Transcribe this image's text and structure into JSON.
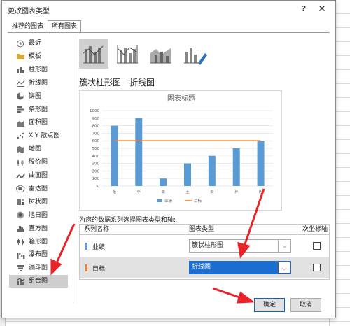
{
  "dialog": {
    "title": "更改图表类型",
    "help_label": "?",
    "close_label": "✕"
  },
  "tabs": [
    "推荐的图表",
    "所有图表"
  ],
  "sidebar": {
    "items": [
      {
        "label": "最近",
        "icon": "recent-icon"
      },
      {
        "label": "模板",
        "icon": "folder-icon"
      },
      {
        "label": "柱形图",
        "icon": "column-chart-icon"
      },
      {
        "label": "折线图",
        "icon": "line-chart-icon"
      },
      {
        "label": "饼图",
        "icon": "pie-chart-icon"
      },
      {
        "label": "条形图",
        "icon": "bar-chart-icon"
      },
      {
        "label": "面积图",
        "icon": "area-chart-icon"
      },
      {
        "label": "X Y 散点图",
        "icon": "scatter-chart-icon"
      },
      {
        "label": "地图",
        "icon": "map-chart-icon"
      },
      {
        "label": "股价图",
        "icon": "stock-chart-icon"
      },
      {
        "label": "曲面图",
        "icon": "surface-chart-icon"
      },
      {
        "label": "雷达图",
        "icon": "radar-chart-icon"
      },
      {
        "label": "树状图",
        "icon": "treemap-chart-icon"
      },
      {
        "label": "旭日图",
        "icon": "sunburst-chart-icon"
      },
      {
        "label": "直方图",
        "icon": "histogram-chart-icon"
      },
      {
        "label": "箱形图",
        "icon": "boxwhisker-chart-icon"
      },
      {
        "label": "瀑布图",
        "icon": "waterfall-chart-icon"
      },
      {
        "label": "漏斗图",
        "icon": "funnel-chart-icon"
      },
      {
        "label": "组合图",
        "icon": "combo-chart-icon",
        "selected": true
      }
    ]
  },
  "combo_type_title": "簇状柱形图 - 折线图",
  "chart_data": {
    "type": "bar",
    "title": "图表标题",
    "categories": [
      "张",
      "李",
      "周",
      "王",
      "吴",
      "孙",
      "巴"
    ],
    "series": [
      {
        "name": "业绩",
        "type": "bar",
        "values": [
          800,
          900,
          100,
          300,
          400,
          500,
          600
        ],
        "color": "#5b9bd5"
      },
      {
        "name": "目标",
        "type": "line",
        "values": [
          600,
          600,
          600,
          600,
          600,
          600,
          600
        ],
        "color": "#ed7d31"
      }
    ],
    "ylim": [
      0,
      1000
    ],
    "yticks": [
      0,
      100,
      200,
      300,
      400,
      500,
      600,
      700,
      800,
      900,
      1000
    ],
    "grid": true,
    "legend_position": "bottom"
  },
  "series_config": {
    "prompt": "为您的数据系列选择图表类型和轴:",
    "headers": {
      "name": "系列名称",
      "type": "图表类型",
      "axis": "次坐标轴"
    },
    "rows": [
      {
        "name": "业绩",
        "color": "#5b9bd5",
        "chart_type": "簇状柱形图",
        "secondary_axis": false
      },
      {
        "name": "目标",
        "color": "#ed7d31",
        "chart_type": "折线图",
        "secondary_axis": false,
        "selected": true
      }
    ]
  },
  "buttons": {
    "ok": "确定",
    "cancel": "取消"
  },
  "colors": {
    "accent": "#1c6fd0",
    "annotation_arrow": "#e8242a"
  }
}
